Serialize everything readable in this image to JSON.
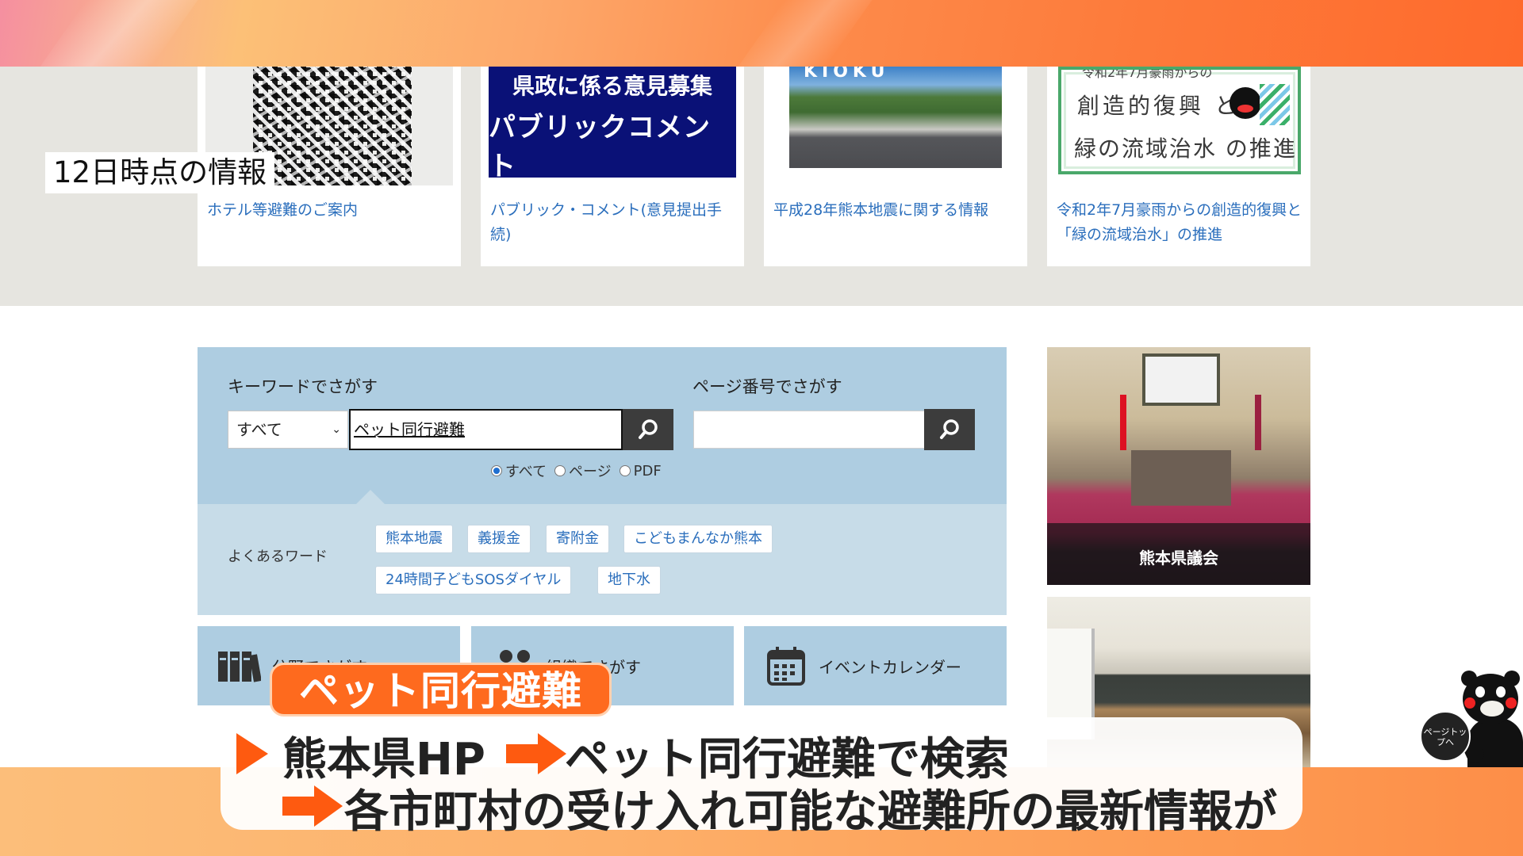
{
  "overlay": {
    "info_label": "12日時点の情報",
    "topic_pill": "ペット同行避難",
    "caption_line1_part1": "熊本県HP",
    "caption_line1_part2": "ペット同行避難で検索",
    "caption_line2": "各市町村の受け入れ可能な避難所の最新情報が"
  },
  "cards": [
    {
      "caption": "ホテル等避難のご案内"
    },
    {
      "caption": "パブリック・コメント(意見提出手続)",
      "banner_line1": "県政に係る意見募集",
      "banner_line2": "パブリックコメント"
    },
    {
      "caption": "平成28年熊本地震に関する情報",
      "photo_text": "KIOKU"
    },
    {
      "caption": "令和2年7月豪雨からの創造的復興と「緑の流域治水」の推進",
      "banner_top": "令和2年7月豪雨からの",
      "banner_line1": "創造的復興 と",
      "banner_line2": "緑の流域治水 の推進"
    }
  ],
  "search": {
    "keyword_label": "キーワードでさがす",
    "page_label": "ページ番号でさがす",
    "scope_selected": "すべて",
    "keyword_value": "ペット同行避難",
    "page_value": "",
    "radio_options": [
      "すべて",
      "ページ",
      "PDF"
    ],
    "radio_selected": 0,
    "faq_label": "よくあるワード",
    "tags": [
      "熊本地震",
      "義援金",
      "寄附金",
      "こどもまんなか熊本",
      "24時間子どもSOSダイヤル",
      "地下水"
    ]
  },
  "quick_links": [
    {
      "label": "分野でさがす",
      "icon": "books-icon"
    },
    {
      "label": "組織でさがす",
      "icon": "people-icon"
    },
    {
      "label": "イベントカレンダー",
      "icon": "calendar-icon"
    }
  ],
  "side": {
    "assembly_caption": "熊本県議会"
  },
  "page_top": {
    "label": "ページトップへ"
  },
  "colors": {
    "accent_orange": "#fe5a10",
    "link_blue": "#2a6ebc",
    "search_panel": "#aecde1",
    "banner_navy": "#0a1177"
  }
}
